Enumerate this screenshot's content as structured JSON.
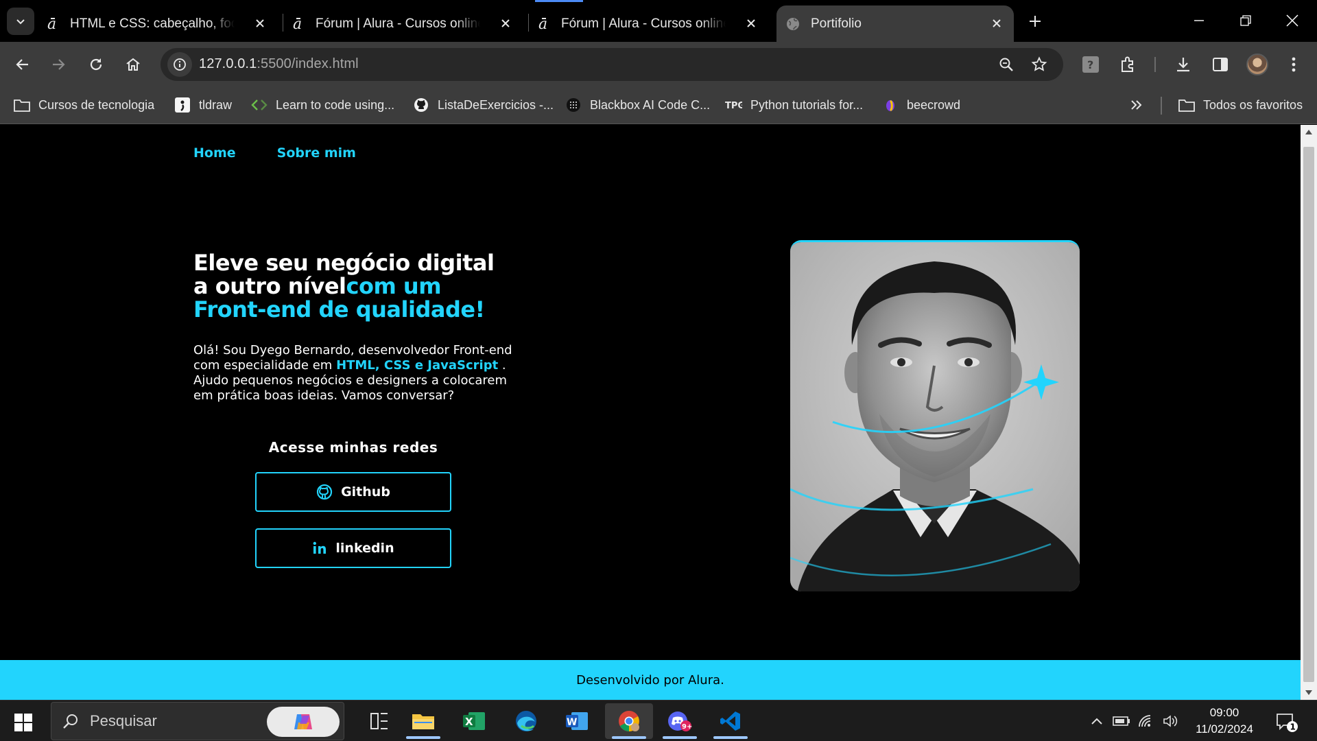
{
  "browser": {
    "tabs": [
      {
        "title": "HTML e CSS: cabeçalho, footer e variáveis CSS",
        "favicon": "alura-icon"
      },
      {
        "title": "Fórum | Alura - Cursos online de tecnologia",
        "favicon": "alura-icon"
      },
      {
        "title": "Fórum | Alura - Cursos online de tecnologia",
        "favicon": "alura-icon"
      },
      {
        "title": "Portifolio",
        "favicon": "globe-icon"
      }
    ],
    "url_host": "127.0.0.1",
    "url_rest": ":5500/index.html",
    "bookmarks": [
      {
        "label": "Cursos de tecnologia",
        "icon": "folder-icon"
      },
      {
        "label": "tldraw",
        "icon": "tldraw-icon"
      },
      {
        "label": "Learn to code using...",
        "icon": "code-icon"
      },
      {
        "label": "ListaDeExercicios -...",
        "icon": "github-icon"
      },
      {
        "label": "Blackbox AI Code C...",
        "icon": "blackbox-icon"
      },
      {
        "label": "Python tutorials for...",
        "icon": "tpg-icon"
      },
      {
        "label": "beecrowd",
        "icon": "beecrowd-icon"
      }
    ],
    "all_bookmarks": "Todos os favoritos",
    "tpg_text": "TPG"
  },
  "site": {
    "nav": [
      "Home",
      "Sobre mim"
    ],
    "headline_white": "Eleve seu negócio digital a outro nível",
    "headline_accent": "com um Front-end de qualidade!",
    "intro_1": "Olá! Sou Dyego Bernardo, desenvolvedor Front-end com especialidade em ",
    "intro_accent": "HTML, CSS e JavaScript",
    "intro_2": " . Ajudo pequenos negócios e designers a colocarem em prática boas ideias. Vamos conversar?",
    "social_title": "Acesse minhas redes",
    "github_label": "Github",
    "linkedin_label": "linkedin",
    "footer": "Desenvolvido por Alura.",
    "accent_color": "#22d4fd"
  },
  "taskbar": {
    "search_placeholder": "Pesquisar",
    "time": "09:00",
    "date": "11/02/2024",
    "notification_count": "1",
    "discord_badge": "9+"
  }
}
